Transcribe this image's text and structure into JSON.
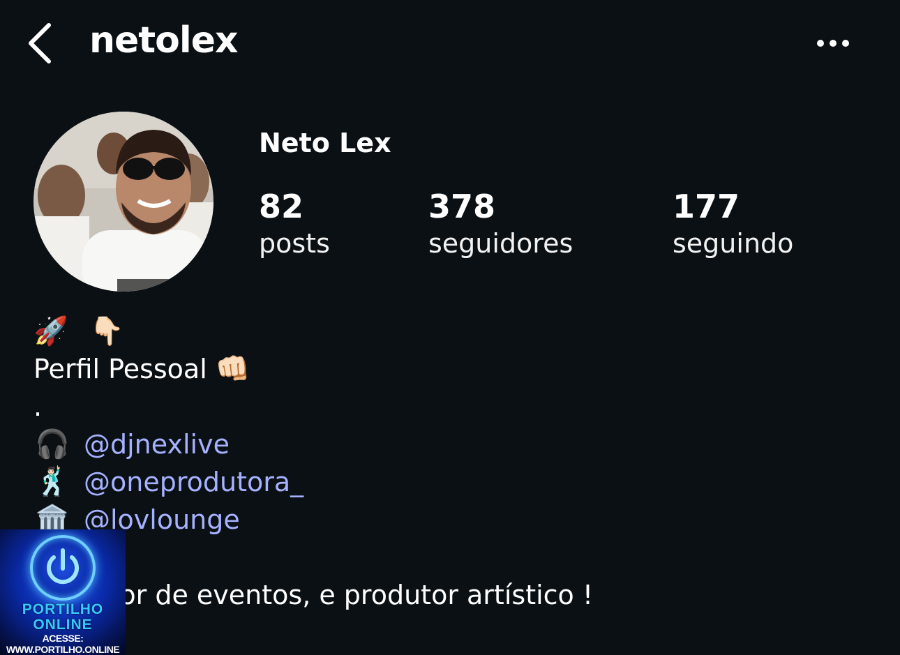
{
  "header": {
    "username": "netolex",
    "back_icon": "chevron-left-icon",
    "more_icon": "more-horizontal-icon"
  },
  "profile": {
    "display_name": "Neto Lex",
    "stats": [
      {
        "value": "82",
        "label": "posts"
      },
      {
        "value": "378",
        "label": "seguidores"
      },
      {
        "value": "177",
        "label": "seguindo"
      }
    ]
  },
  "bio": {
    "line1_emojis": [
      "🚀",
      "👇🏻"
    ],
    "line2_text": "Perfil Pessoal",
    "line2_emoji": "👊🏻",
    "line3_text": ".",
    "links": [
      {
        "emoji": "🎧",
        "handle": "@djnexlive"
      },
      {
        "emoji": "🕺🏻",
        "handle": "@oneprodutora_"
      },
      {
        "emoji": "🏛️",
        "handle": "@lovlounge"
      }
    ],
    "last_line": "Produtor de eventos, e produtor artístico !"
  },
  "watermark": {
    "line1": "PORTILHO",
    "line2": "ONLINE",
    "line3": "ACESSE: WWW.PORTILHO.ONLINE"
  }
}
